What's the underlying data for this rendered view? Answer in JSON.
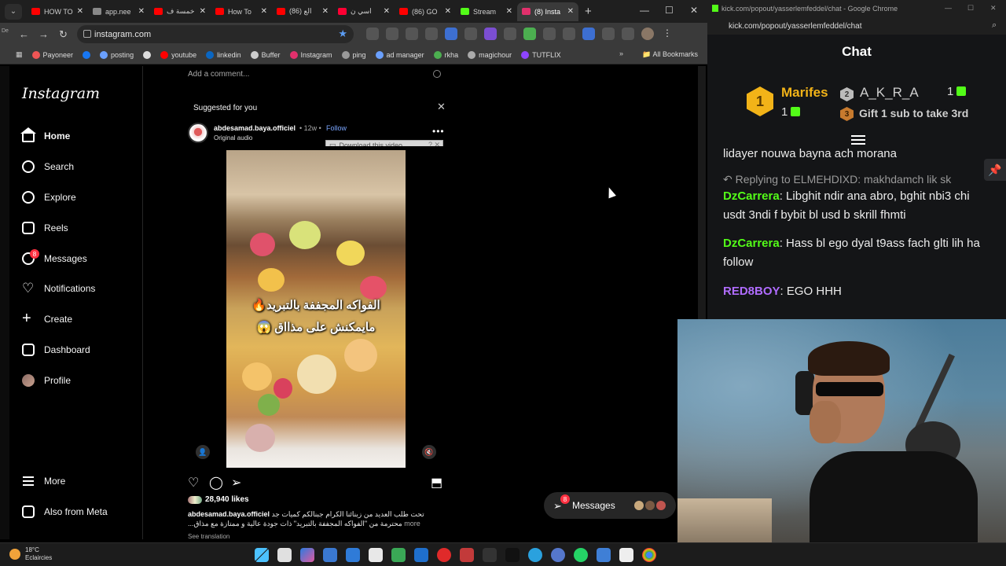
{
  "browser": {
    "tabs": [
      {
        "label": "HOW TO",
        "color": "#ff0000"
      },
      {
        "label": "app.nee",
        "color": "#888888"
      },
      {
        "label": "خمسة ف",
        "color": "#ff0000"
      },
      {
        "label": "How To",
        "color": "#ff0000"
      },
      {
        "label": "(86) الع",
        "color": "#ff0000"
      },
      {
        "label": "اسي ن",
        "color": "#ff0033"
      },
      {
        "label": "(86) GO",
        "color": "#ff0000"
      },
      {
        "label": "Stream",
        "color": "#53fc18"
      },
      {
        "label": "(8) Insta",
        "color": "#e1306c"
      }
    ],
    "url": "instagram.com",
    "bookmarks": [
      {
        "label": "Payoneer",
        "color": "#e55"
      },
      {
        "label": "",
        "color": "#1877f2"
      },
      {
        "label": "posting",
        "color": "#6aa0ff"
      },
      {
        "label": "",
        "color": "#ddd"
      },
      {
        "label": "youtube",
        "color": "#ff0000"
      },
      {
        "label": "linkedin",
        "color": "#0a66c2"
      },
      {
        "label": "Buffer",
        "color": "#ccc"
      },
      {
        "label": "Instagram",
        "color": "#e1306c"
      },
      {
        "label": "ping",
        "color": "#999"
      },
      {
        "label": "ad manager",
        "color": "#6aa0ff"
      },
      {
        "label": "rkha",
        "color": "#4caf50"
      },
      {
        "label": "magichour",
        "color": "#aaa"
      },
      {
        "label": "TUTFLIX",
        "color": "#8e44ff"
      }
    ],
    "all_bookmarks": "All Bookmarks"
  },
  "instagram": {
    "logo": "Instagram",
    "nav": [
      {
        "label": "Home",
        "icon": "home-icon"
      },
      {
        "label": "Search",
        "icon": "search-icon"
      },
      {
        "label": "Explore",
        "icon": "explore-icon"
      },
      {
        "label": "Reels",
        "icon": "reels-icon"
      },
      {
        "label": "Messages",
        "icon": "messages-icon",
        "badge": "8"
      },
      {
        "label": "Notifications",
        "icon": "heart-icon"
      },
      {
        "label": "Create",
        "icon": "plus-icon"
      },
      {
        "label": "Dashboard",
        "icon": "dashboard-icon"
      },
      {
        "label": "Profile",
        "icon": "avatar"
      }
    ],
    "more": "More",
    "also_meta": "Also from Meta",
    "add_comment": "Add a comment...",
    "suggested": "Suggested for you",
    "post": {
      "username": "abdesamad.baya.officiel",
      "time": "• 12w •",
      "follow": "Follow",
      "audio": "Original audio",
      "download_label": "Download this video",
      "caption_line1": "الفواكه المجففة بالتبريد🔥",
      "caption_line2": "مايمكنش على مذااق 😱",
      "likes": "28,940 likes",
      "caption_user": "abdesamad.baya.officiel",
      "caption_text": "تحت طلب العديد من زبنائنا الكرام جبنالكم كميات جد محترمة من \"الفواكه المجففة بالتبريد\" ذات جودة عالية و ممتازة مع مذاق...",
      "more": "more",
      "see_translation": "See translation"
    },
    "messages_pill": {
      "label": "Messages",
      "badge": "8"
    }
  },
  "kick": {
    "window_title": "kick.com/popout/yasserlemfeddel/chat - Google Chrome",
    "url": "kick.com/popout/yasserlemfeddel/chat",
    "chat_title": "Chat",
    "leaderboard": {
      "first": {
        "rank": "1",
        "name": "Marifes",
        "count": "1"
      },
      "second": {
        "rank": "2",
        "name": "A_K_R_A",
        "count": "1"
      },
      "third": {
        "rank": "3",
        "label": "Gift 1 sub to take 3rd"
      }
    },
    "messages": [
      {
        "user": "",
        "text": "lidayer nouwa bayna ach morana"
      },
      {
        "reply": "↶ Replying to ELMEHDIXD: makhdamch lik sk"
      },
      {
        "user": "DzCarrera",
        "text": " Libghit ndir ana abro, bghit nbi3 chi usdt 3ndi f bybit bl usd b skrill fhmti"
      },
      {
        "user": "DzCarrera",
        "text": " Hass bl ego dyal t9ass fach glti lih ha follow"
      },
      {
        "user": "RED8BOY",
        "text": " EGO HHH"
      }
    ]
  },
  "taskbar": {
    "temp": "18°C",
    "condition": "Eclaircies"
  }
}
